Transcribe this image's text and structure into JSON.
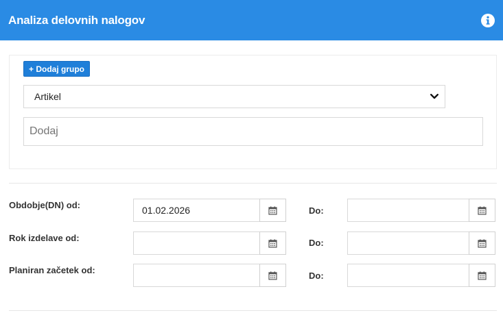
{
  "header": {
    "title": "Analiza delovnih nalogov",
    "info_icon": "info-circle-icon",
    "background": "#2a8be4"
  },
  "group_panel": {
    "add_group_label": "+ Dodaj grupo",
    "select_value": "Artikel",
    "add_placeholder": "Dodaj"
  },
  "filters": {
    "to_label": "Do:",
    "rows": [
      {
        "label": "Obdobje(DN) od:",
        "from_value": "01.02.2026",
        "to_value": ""
      },
      {
        "label": "Rok izdelave od:",
        "from_value": "",
        "to_value": ""
      },
      {
        "label": "Planiran začetek od:",
        "from_value": "",
        "to_value": ""
      }
    ]
  }
}
